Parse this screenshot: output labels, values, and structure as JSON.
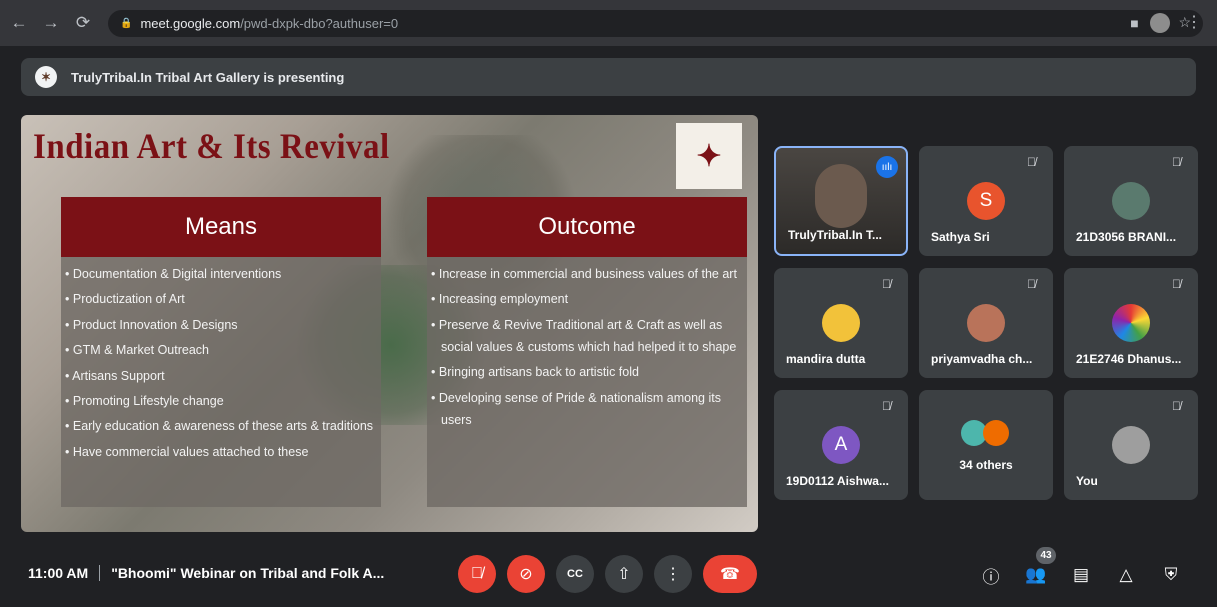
{
  "browser": {
    "url_host": "meet.google.com",
    "url_path": "/pwd-dxpk-dbo?authuser=0"
  },
  "banner": {
    "text": "TrulyTribal.In Tribal Art Gallery is presenting"
  },
  "slide": {
    "title": "Indian Art & Its Revival",
    "means": {
      "heading": "Means",
      "items": [
        "Documentation & Digital interventions",
        "Productization of Art",
        "Product Innovation & Designs",
        "GTM & Market Outreach",
        "Artisans Support",
        "Promoting Lifestyle change",
        "Early education & awareness of these arts & traditions",
        "Have commercial values attached to these"
      ]
    },
    "outcome": {
      "heading": "Outcome",
      "items": [
        "Increase in commercial and business values of the art",
        "Increasing employment",
        "Preserve & Revive Traditional art & Craft as well as social values & customs which had helped it to shape",
        "Bringing artisans back to artistic fold",
        "Developing sense of Pride & nationalism among its users"
      ]
    }
  },
  "participants": [
    {
      "name": "TrulyTribal.In T...",
      "initial": "",
      "color": "#6b5a4e",
      "muted": false
    },
    {
      "name": "Sathya Sri",
      "initial": "S",
      "color": "#e8542d",
      "muted": true
    },
    {
      "name": "21D3056 BRANI...",
      "initial": "",
      "color": "#5a7a6e",
      "muted": true
    },
    {
      "name": "mandira dutta",
      "initial": "",
      "color": "#f2c23a",
      "muted": true
    },
    {
      "name": "priyamvadha ch...",
      "initial": "",
      "color": "#b9735a",
      "muted": true
    },
    {
      "name": "21E2746 Dhanus...",
      "initial": "",
      "color": "#ffffff",
      "muted": true
    },
    {
      "name": "19D0112 Aishwa...",
      "initial": "A",
      "color": "#7e57c2",
      "muted": true
    },
    {
      "name": "34 others",
      "initial": "",
      "color": "#4db6ac",
      "muted": false
    },
    {
      "name": "You",
      "initial": "",
      "color": "#9e9e9e",
      "muted": true
    }
  ],
  "bottom": {
    "time": "11:00 AM",
    "meeting_title": "\"Bhoomi\" Webinar on Tribal and Folk A...",
    "people_count": "43"
  }
}
